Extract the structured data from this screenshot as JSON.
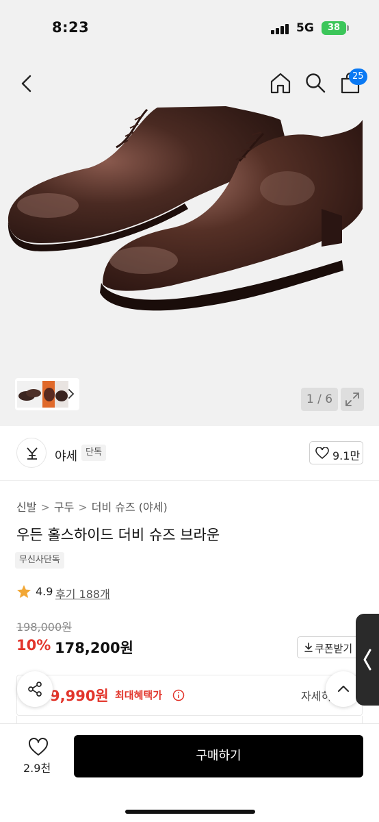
{
  "status_bar": {
    "time": "8:23",
    "network": "5G",
    "battery": "38"
  },
  "top_nav": {
    "cart_count": "25"
  },
  "gallery": {
    "pager": "1 / 6"
  },
  "brand": {
    "name": "야세",
    "tag": "단독",
    "likes": "9.1만"
  },
  "breadcrumb": {
    "items": [
      "신발",
      "구두",
      "더비 슈즈 (야세)"
    ]
  },
  "product": {
    "title": "우든 홀스하이드 더비 슈즈 브라운",
    "exclusive_tag": "무신사단독",
    "rating": "4.9",
    "reviews": "후기 188개",
    "original_price": "198,000원",
    "discount": "10%",
    "sale_price": "178,200원",
    "coupon_button": "쿠폰받기"
  },
  "benefit": {
    "price": "9,990원",
    "label": "최대혜택가",
    "detail": "자세히"
  },
  "bottom_bar": {
    "wish_count": "2.9천",
    "buy_label": "구매하기"
  },
  "colors": {
    "accent_red": "#e2352b",
    "badge_blue": "#0a79f3",
    "battery_green": "#3cc65a",
    "leather_brown": "#4a2a22"
  }
}
